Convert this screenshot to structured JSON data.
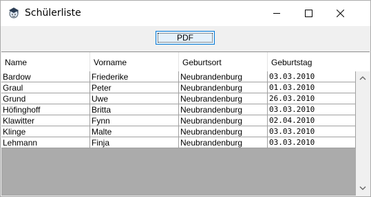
{
  "window": {
    "title": "Schülerliste",
    "icons": {
      "app": "student-cap-icon",
      "minimize": "minimize-icon",
      "maximize": "maximize-icon",
      "close": "close-icon"
    }
  },
  "toolbar": {
    "pdf_label": "PDF"
  },
  "table": {
    "columns": [
      "Name",
      "Vorname",
      "Geburtsort",
      "Geburtstag"
    ],
    "rows": [
      [
        "Bardow",
        "Friederike",
        "Neubrandenburg",
        "03.03.2010"
      ],
      [
        "Graul",
        "Peter",
        "Neubrandenburg",
        "01.03.2010"
      ],
      [
        "Grund",
        "Uwe",
        "Neubrandenburg",
        "26.03.2010"
      ],
      [
        "Höfinghoff",
        "Britta",
        "Neubrandenburg",
        "03.03.2010"
      ],
      [
        "Klawitter",
        "Fynn",
        "Neubrandenburg",
        "02.04.2010"
      ],
      [
        "Klinge",
        "Malte",
        "Neubrandenburg",
        "03.03.2010"
      ],
      [
        "Lehmann",
        "Finja",
        "Neubrandenburg",
        "03.03.2010"
      ]
    ]
  },
  "scrollbar": {
    "up": "chevron-up-icon",
    "down": "chevron-down-icon"
  }
}
